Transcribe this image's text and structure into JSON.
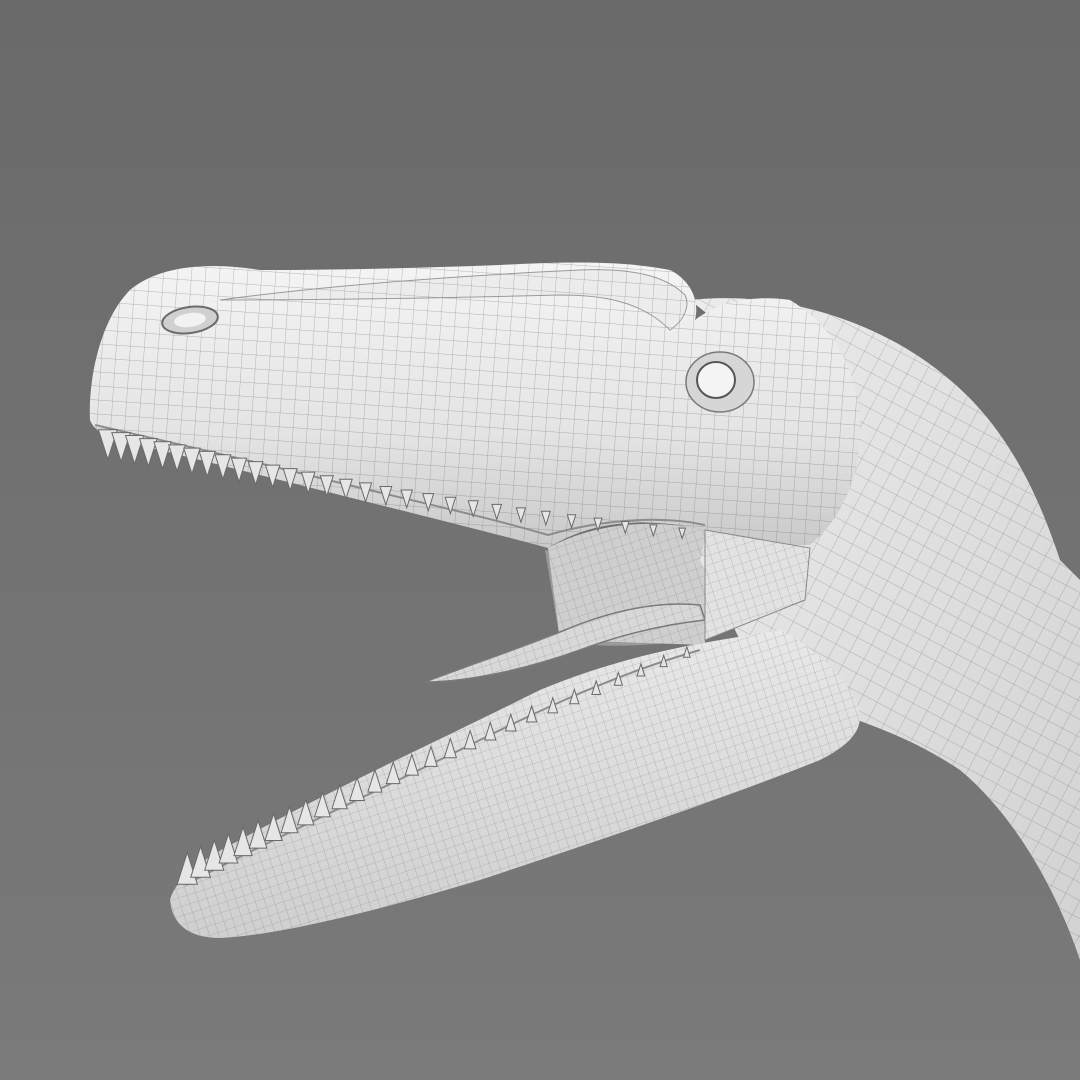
{
  "scene": {
    "subject": "dinosaur-head-wireframe",
    "background_top": "#6a6a6a",
    "background_bottom": "#7a7a7a",
    "skin_light": "#f0f0f0",
    "skin_mid": "#d9d9d9",
    "skin_shadow": "#b8b8b8",
    "wire_color": "#555555",
    "tooth_color": "#e6e6e6"
  }
}
